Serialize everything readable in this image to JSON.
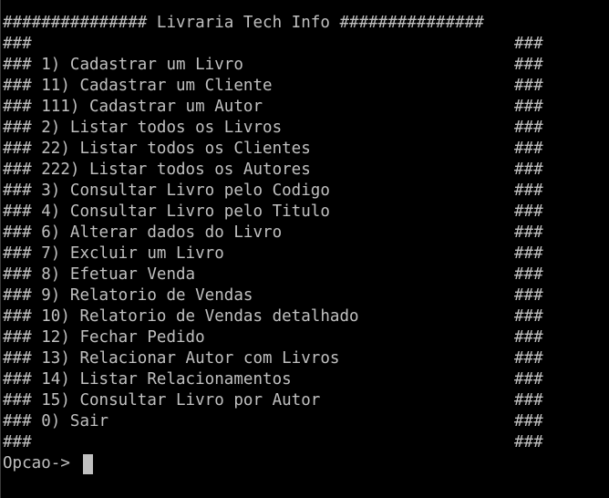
{
  "terminal": {
    "title_line": "############### Livraria Tech Info ###############",
    "border_left": "###",
    "border_right": "###",
    "menu_items": [
      "### 1) Cadastrar um Livro",
      "### 11) Cadastrar um Cliente",
      "### 111) Cadastrar um Autor",
      "### 2) Listar todos os Livros",
      "### 22) Listar todos os Clientes",
      "### 222) Listar todos os Autores",
      "### 3) Consultar Livro pelo Codigo",
      "### 4) Consultar Livro pelo Titulo",
      "### 6) Alterar dados do Livro",
      "### 7) Excluir um Livro",
      "### 8) Efetuar Venda",
      "### 9) Relatorio de Vendas",
      "### 10) Relatorio de Vendas detalhado",
      "### 12) Fechar Pedido",
      "### 13) Relacionar Autor com Livros",
      "### 14) Listar Relacionamentos",
      "### 15) Consultar Livro por Autor",
      "### 0) Sair"
    ],
    "prompt": "Opcao->",
    "colors": {
      "background": "#000000",
      "text": "#c0c0c0"
    }
  }
}
